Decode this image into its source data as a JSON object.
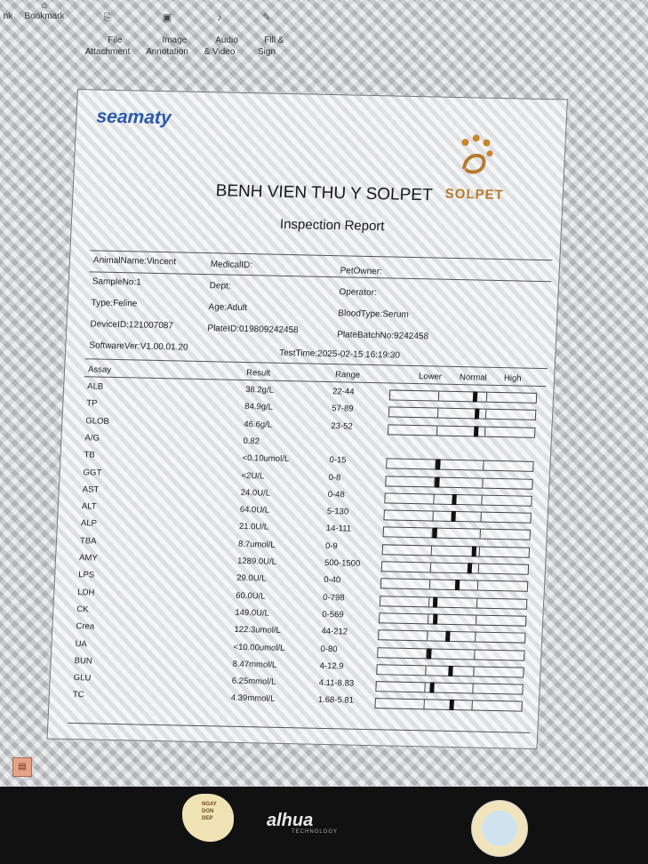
{
  "toolbar": {
    "items": [
      {
        "label": "nk",
        "icon": "link-icon"
      },
      {
        "label": "Bookmark",
        "icon": "bookmark-icon"
      },
      {
        "label": "File\nAttachment",
        "icon": "paperclip-icon"
      },
      {
        "label": "Image\nAnnotation",
        "icon": "image-icon"
      },
      {
        "label": "Audio\n& Video",
        "icon": "audio-icon"
      },
      {
        "label": "Fill &\nSign",
        "icon": "pen-icon"
      }
    ]
  },
  "report": {
    "brand": "seamaty",
    "logo_text": "SOLPET",
    "hospital_title": "BENH VIEN THU Y SOLPET",
    "subtitle": "Inspection Report",
    "info": {
      "animal_name": "AnimalName:Vincent",
      "medical_id": "MedicalID:",
      "pet_owner": "PetOwner:",
      "sample_no": "SampleNo:1",
      "dept": "Dept:",
      "operator": "Operator:",
      "type": "Type:Feline",
      "age": "Age:Adult",
      "blood_type": "BloodType:Serum",
      "device_id": "DeviceID:121007087",
      "plate_id": "PlateID:019809242458",
      "plate_batch": "PlateBatchNo:9242458",
      "software_ver": "SoftwareVer:V1.00.01.20",
      "test_time": "TestTime:2025-02-15 16:19:30"
    },
    "columns": {
      "assay": "Assay",
      "result": "Result",
      "range": "Range",
      "lower": "Lower",
      "normal": "Normal",
      "high": "High"
    },
    "rows": [
      {
        "assay": "ALB",
        "result": "38.2g/L",
        "range": "22-44",
        "marker": 0.58,
        "bar": true
      },
      {
        "assay": "TP",
        "result": "84.9g/L",
        "range": "57-89",
        "marker": 0.6,
        "bar": true
      },
      {
        "assay": "GLOB",
        "result": "46.6g/L",
        "range": "23-52",
        "marker": 0.6,
        "bar": true
      },
      {
        "assay": "A/G",
        "result": "0.82",
        "range": "",
        "marker": null,
        "bar": false
      },
      {
        "assay": "TB",
        "result": "<0.10umol/L",
        "range": "0-15",
        "marker": 0.35,
        "bar": true
      },
      {
        "assay": "GGT",
        "result": "<2U/L",
        "range": "0-8",
        "marker": 0.35,
        "bar": true
      },
      {
        "assay": "AST",
        "result": "24.0U/L",
        "range": "0-48",
        "marker": 0.47,
        "bar": true
      },
      {
        "assay": "ALT",
        "result": "64.0U/L",
        "range": "5-130",
        "marker": 0.47,
        "bar": true
      },
      {
        "assay": "ALP",
        "result": "21.0U/L",
        "range": "14-111",
        "marker": 0.35,
        "bar": true
      },
      {
        "assay": "TBA",
        "result": "8.7umol/L",
        "range": "0-9",
        "marker": 0.62,
        "bar": true
      },
      {
        "assay": "AMY",
        "result": "1289.0U/L",
        "range": "500-1500",
        "marker": 0.6,
        "bar": true
      },
      {
        "assay": "LPS",
        "result": "29.0U/L",
        "range": "0-40",
        "marker": 0.52,
        "bar": true
      },
      {
        "assay": "LDH",
        "result": "60.0U/L",
        "range": "0-798",
        "marker": 0.37,
        "bar": true
      },
      {
        "assay": "CK",
        "result": "149.0U/L",
        "range": "0-569",
        "marker": 0.38,
        "bar": true
      },
      {
        "assay": "Crea",
        "result": "122.3umol/L",
        "range": "44-212",
        "marker": 0.47,
        "bar": true
      },
      {
        "assay": "UA",
        "result": "<10.00umol/L",
        "range": "0-80",
        "marker": 0.35,
        "bar": true
      },
      {
        "assay": "BUN",
        "result": "8.47mmol/L",
        "range": "4-12.9",
        "marker": 0.5,
        "bar": true
      },
      {
        "assay": "GLU",
        "result": "6.25mmol/L",
        "range": "4.11-8.83",
        "marker": 0.38,
        "bar": true
      },
      {
        "assay": "TC",
        "result": "4.39mmol/L",
        "range": "1.68-5.81",
        "marker": 0.52,
        "bar": true
      }
    ]
  },
  "bezel": {
    "brand": "alhua",
    "brand_sub": "TECHNOLOGY",
    "sticker_text": "NGAY\nDON\nDEP"
  },
  "colors": {
    "brand_blue": "#2a5aa8",
    "logo_gold": "#b77a2a",
    "bezel": "#111111"
  }
}
